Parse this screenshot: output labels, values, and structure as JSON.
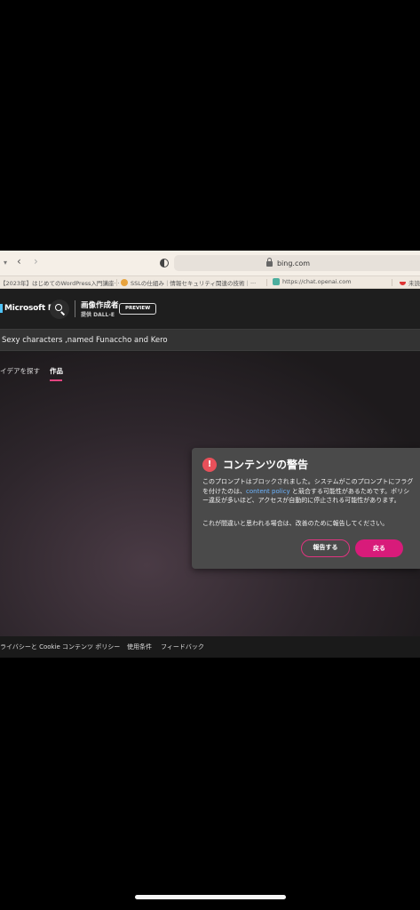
{
  "browser": {
    "url": "bing.com",
    "bookmarks": [
      "【2023年】はじめてのWordPress入門講座···",
      "SSLの仕組み｜情報セキュリティ関連の技術｜···",
      "https://chat.openai.com",
      "未読 ("
    ]
  },
  "bing": {
    "brand": "Microsoft Bing",
    "creator_title": "画像作成者",
    "creator_sub": "提供 DALL-E",
    "preview_label": "PREVIEW",
    "prompt": "Sexy characters ,named Funaccho and Kero",
    "tabs": {
      "explore": "イデアを探す",
      "works": "作品"
    },
    "dialog": {
      "icon": "!",
      "title": "コンテンツの警告",
      "body_before": "このプロンプトはブロックされました。システムがこのプロンプトにフラグを付けたのは、",
      "body_link": "content policy",
      "body_after": " と競合する可能性があるためです。ポリシー違反が多いほど、アクセスが自動的に停止される可能性があります。",
      "body2": "これが間違いと思われる場合は、改善のために報告してください。",
      "report_button": "報告する",
      "back_button": "戻る"
    },
    "footer": [
      "ライバシーと Cookie",
      "コンテンツ ポリシー",
      "使用条件",
      "フィードバック"
    ]
  },
  "colors": {
    "accent": "#d81b7a",
    "warning": "#e8505a",
    "link": "#6cb4ff"
  }
}
